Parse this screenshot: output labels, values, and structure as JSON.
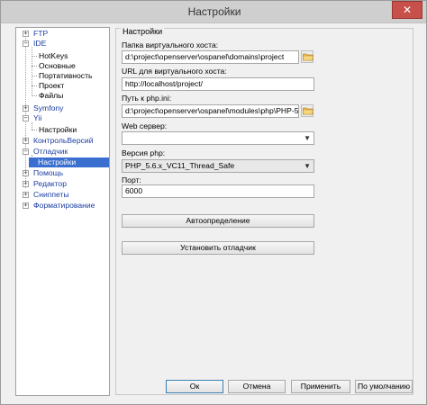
{
  "window": {
    "title": "Настройки",
    "close_glyph": "✕"
  },
  "tree": {
    "items": [
      {
        "label": "FTP",
        "expander": "+"
      },
      {
        "label": "IDE",
        "expander": "−"
      },
      {
        "label": "HotKeys"
      },
      {
        "label": "Основные"
      },
      {
        "label": "Портативность"
      },
      {
        "label": "Проект"
      },
      {
        "label": "Файлы"
      },
      {
        "label": "Symfony",
        "expander": "+"
      },
      {
        "label": "Yii",
        "expander": "−"
      },
      {
        "label": "Настройки"
      },
      {
        "label": "КонтрольВерсий",
        "expander": "+"
      },
      {
        "label": "Отладчик",
        "expander": "−"
      },
      {
        "label": "Настройки",
        "selected": true
      },
      {
        "label": "Помощь",
        "expander": "+"
      },
      {
        "label": "Редактор",
        "expander": "+"
      },
      {
        "label": "Сниппеты",
        "expander": "+"
      },
      {
        "label": "Форматирование",
        "expander": "+"
      }
    ]
  },
  "settings": {
    "group_title": "Настройки",
    "host_folder": {
      "label": "Папка виртуального хоста:",
      "value": "d:\\project\\openserver\\ospanel\\domains\\project"
    },
    "host_url": {
      "label": "URL для виртуального хоста:",
      "value": "http://localhost/project/"
    },
    "php_ini": {
      "label": "Путь к php.ini:",
      "value": "d:\\project\\openserver\\ospanel\\modules\\php\\PHP-5.6"
    },
    "web_server": {
      "label": "Web сервер:",
      "value": ""
    },
    "php_version": {
      "label": "Версия php:",
      "value": "PHP_5.6.x_VC11_Thread_Safe"
    },
    "port": {
      "label": "Порт:",
      "value": "6000"
    },
    "autodetect_label": "Автоопределение",
    "install_debugger_label": "Установить отладчик",
    "dropdown_glyph": "▼"
  },
  "footer": {
    "ok_label": "Ок",
    "cancel_label": "Отмена",
    "apply_label": "Применить",
    "default_label": "По умолчанию"
  },
  "icons": {
    "folder": "folder-icon",
    "close": "close-icon",
    "dropdown": "chevron-down-icon"
  }
}
